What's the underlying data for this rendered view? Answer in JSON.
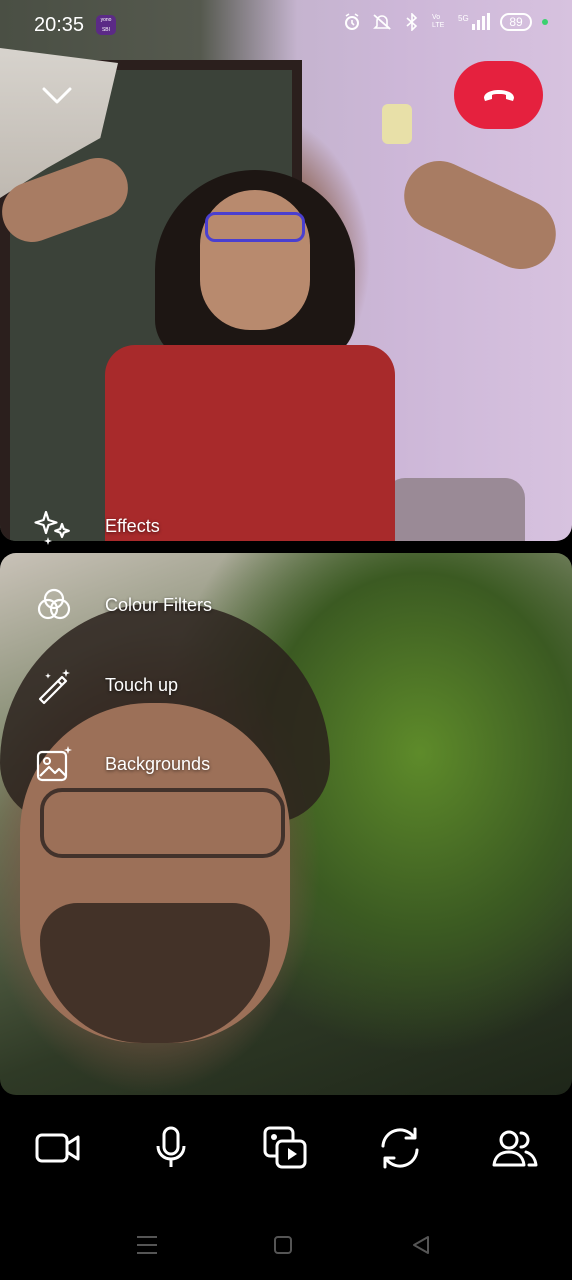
{
  "status_bar": {
    "time": "20:35",
    "app_badge_text": "yono SBI",
    "battery_level": "89",
    "network_label": "5G",
    "volte_label": "Vo LTE",
    "icons": [
      "alarm-icon",
      "mute-icon",
      "bluetooth-icon",
      "volte-icon",
      "signal-5g-icon",
      "battery-icon"
    ]
  },
  "call": {
    "collapse_icon": "chevron-down-icon",
    "end_call_icon": "phone-hangup-icon",
    "end_call_color": "#e5213e"
  },
  "effects_menu": {
    "items": [
      {
        "label": "Effects",
        "icon": "sparkles-icon"
      },
      {
        "label": "Colour Filters",
        "icon": "color-filters-icon"
      },
      {
        "label": "Touch up",
        "icon": "magic-wand-icon"
      },
      {
        "label": "Backgrounds",
        "icon": "background-image-icon"
      }
    ]
  },
  "controls": {
    "items": [
      {
        "name": "camera-toggle",
        "icon": "video-camera-icon"
      },
      {
        "name": "mic-toggle",
        "icon": "microphone-icon"
      },
      {
        "name": "media-share",
        "icon": "media-share-icon"
      },
      {
        "name": "flip-camera",
        "icon": "flip-camera-icon"
      },
      {
        "name": "participants",
        "icon": "people-icon"
      }
    ]
  },
  "nav_bar": {
    "icons": [
      "menu-icon",
      "home-icon",
      "back-icon"
    ]
  }
}
